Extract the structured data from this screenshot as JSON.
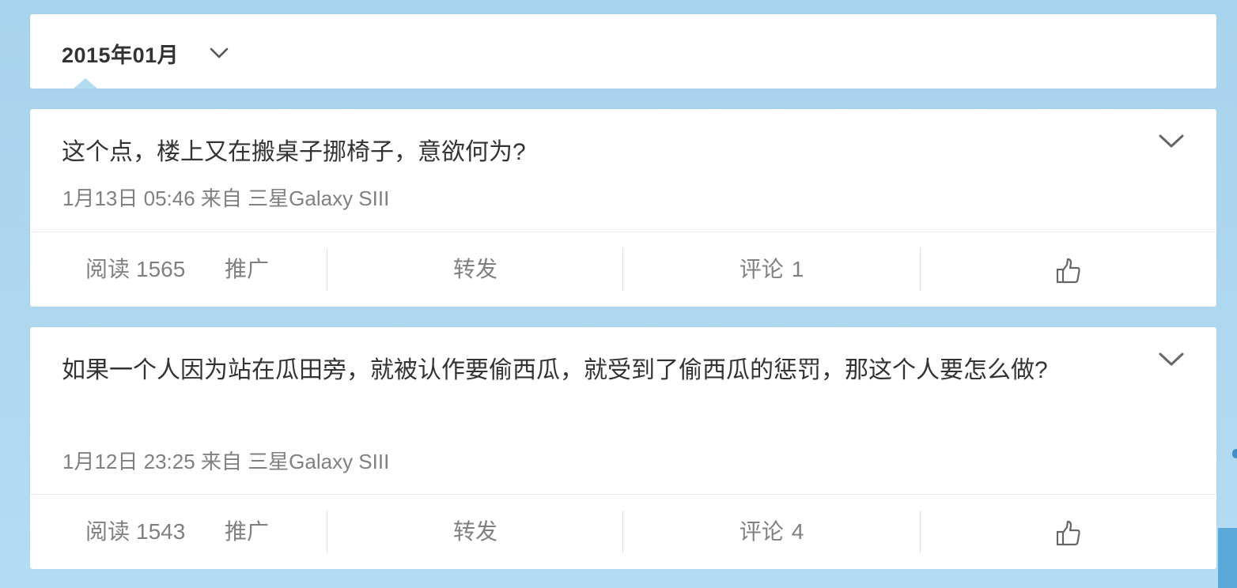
{
  "month_selector": {
    "label": "2015年01月",
    "icon": "chevron-down-icon"
  },
  "posts": [
    {
      "text": "这个点，楼上又在搬桌子挪椅子，意欲何为?",
      "time": "1月13日 05:46",
      "source_prefix": "来自",
      "source": "三星Galaxy SIII",
      "read_label": "阅读",
      "read_count": "1565",
      "promote_label": "推广",
      "forward_label": "转发",
      "comment_label": "评论",
      "comment_count": "1",
      "like_icon": "thumbs-up-icon",
      "menu_icon": "chevron-down-icon"
    },
    {
      "text": "如果一个人因为站在瓜田旁，就被认作要偷西瓜，就受到了偷西瓜的惩罚，那这个人要怎么做?",
      "time": "1月12日 23:25",
      "source_prefix": "来自",
      "source": "三星Galaxy SIII",
      "read_label": "阅读",
      "read_count": "1543",
      "promote_label": "推广",
      "forward_label": "转发",
      "comment_label": "评论",
      "comment_count": "4",
      "like_icon": "thumbs-up-icon",
      "menu_icon": "chevron-down-icon"
    }
  ],
  "colors": {
    "background": "#a8d3ec",
    "card": "#ffffff",
    "text_primary": "#333333",
    "text_secondary": "#808080",
    "divider": "#e0e0e0"
  }
}
